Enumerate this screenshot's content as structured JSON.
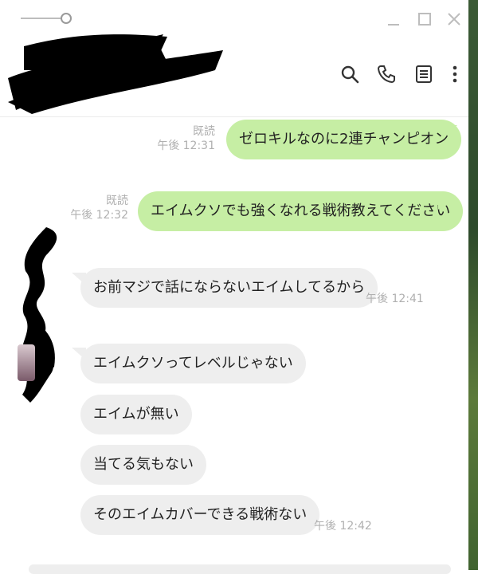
{
  "window": {
    "pin_icon": "pin-slider-icon",
    "controls": [
      "minimize-icon",
      "maximize-icon",
      "close-icon"
    ]
  },
  "header": {
    "icons": [
      "search-icon",
      "phone-icon",
      "notes-icon",
      "more-vertical-icon"
    ]
  },
  "messages": [
    {
      "direction": "out",
      "text": "ゼロキルなのに2連チャンピオン",
      "read": "既読",
      "time": "午後 12:31"
    },
    {
      "direction": "out",
      "text": "エイムクソでも強くなれる戦術教えてください",
      "read": "既読",
      "time": "午後 12:32"
    },
    {
      "direction": "in",
      "text": "お前マジで話にならないエイムしてるから",
      "time": "午後 12:41"
    },
    {
      "direction": "in",
      "text": "エイムクソってレベルじゃない"
    },
    {
      "direction": "in",
      "text": "エイムが無い"
    },
    {
      "direction": "in",
      "text": "当てる気もない"
    },
    {
      "direction": "in",
      "text": "そのエイムカバーできる戦術ない",
      "time": "午後 12:42"
    }
  ],
  "colors": {
    "outgoing_bubble": "#c6eea4",
    "incoming_bubble": "#eeeeee",
    "meta_text": "#b0b0b0"
  }
}
